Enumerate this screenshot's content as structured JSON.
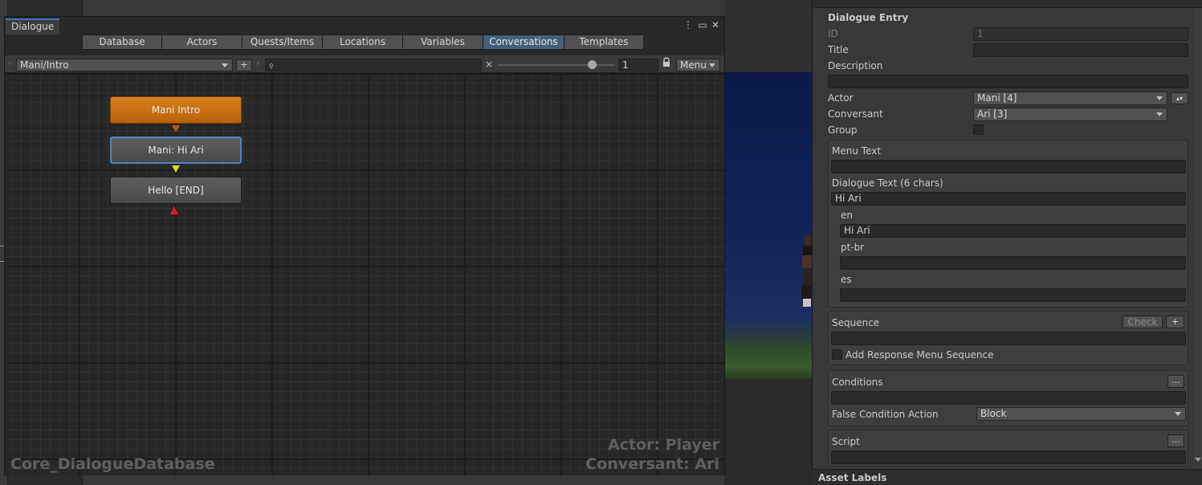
{
  "window": {
    "tab_title": "Dialogue",
    "more_icon": "⋮",
    "maximize_icon": "▭",
    "close_icon": "✕"
  },
  "tabs": [
    {
      "label": "Database"
    },
    {
      "label": "Actors"
    },
    {
      "label": "Quests/Items"
    },
    {
      "label": "Locations"
    },
    {
      "label": "Variables"
    },
    {
      "label": "Conversations",
      "active": true
    },
    {
      "label": "Templates"
    }
  ],
  "toolbar": {
    "conversation_select": "Mani/Intro",
    "add_label": "+",
    "search_value": "",
    "search_icon": "🔍",
    "clear_icon": "×",
    "zoom_value": "1",
    "zoom_fraction": 0.8,
    "menu_label": "Menu",
    "lock_icon": "🔒"
  },
  "nodes": [
    {
      "label": "Mani Intro",
      "kind": "start"
    },
    {
      "label": "Mani: Hi Ari",
      "kind": "selected"
    },
    {
      "label": "Hello [END]",
      "kind": "end"
    }
  ],
  "watermarks": {
    "database": "Core_DialogueDatabase",
    "actor": "Actor: Player",
    "conversant": "Conversant: Ari"
  },
  "inspector": {
    "header": "Dialogue Entry",
    "id_label": "ID",
    "id_value": "1",
    "title_label": "Title",
    "title_value": "",
    "description_label": "Description",
    "description_value": "",
    "actor_label": "Actor",
    "actor_value": "Mani [4]",
    "conversant_label": "Conversant",
    "conversant_value": "Ari [3]",
    "group_label": "Group",
    "menu_text_label": "Menu Text",
    "menu_text_value": "",
    "dialogue_text_label": "Dialogue Text (6 chars)",
    "dialogue_text_value": "Hi Ari",
    "localizations": [
      {
        "lang": "en",
        "value": "Hi Ari"
      },
      {
        "lang": "pt-br",
        "value": ""
      },
      {
        "lang": "es",
        "value": ""
      }
    ],
    "sequence_label": "Sequence",
    "sequence_check": "Check",
    "sequence_add": "+",
    "sequence_value": "",
    "add_response_label": "Add Response Menu Sequence",
    "conditions_label": "Conditions",
    "conditions_more": "...",
    "conditions_value": "",
    "false_condition_label": "False Condition Action",
    "false_condition_value": "Block",
    "script_label": "Script",
    "script_more": "...",
    "script_value": "",
    "asset_labels": "Asset Labels"
  }
}
